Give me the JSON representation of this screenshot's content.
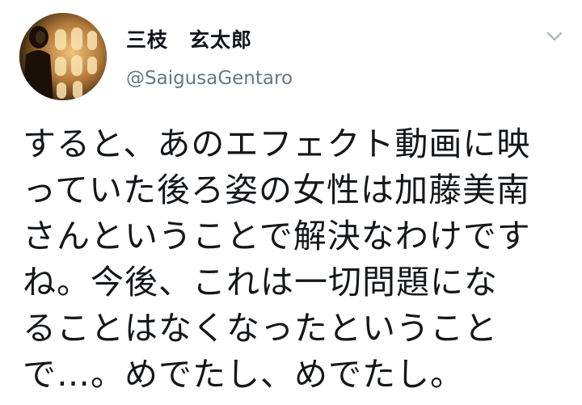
{
  "tweet": {
    "author": {
      "display_name": "三枝　玄太郎",
      "handle": "@SaigusaGentaro",
      "avatar_icon": "profile-photo"
    },
    "menu_icon": "chevron-down-icon",
    "text_lines": [
      "すると、あのエフェクト動画に映",
      "っていた後ろ姿の女性は加藤美南",
      "さんということで解決なわけです",
      "ね。今後、これは一切問題にな",
      "ることはなくなったということ",
      "で…。めでたし、めでたし。"
    ]
  }
}
